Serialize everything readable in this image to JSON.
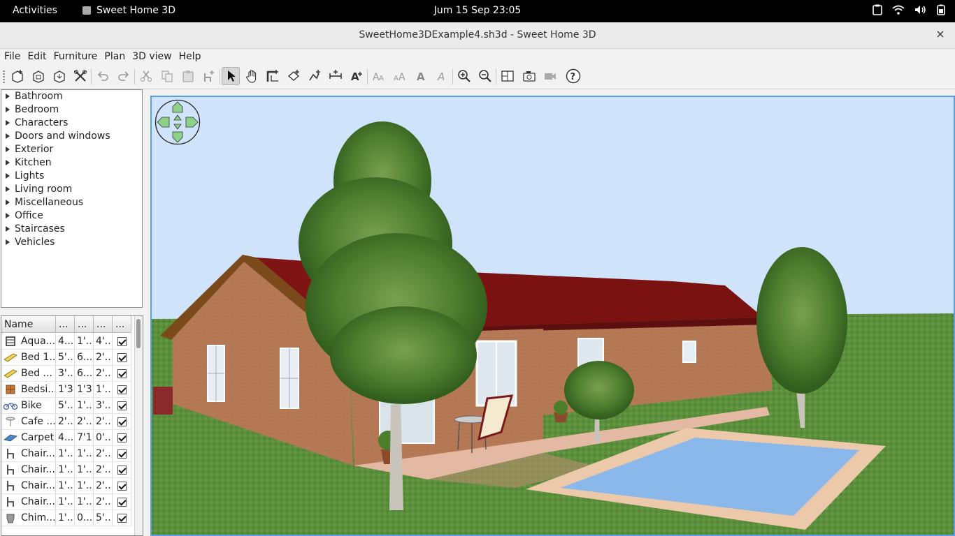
{
  "topbar": {
    "activities": "Activities",
    "app_name": "Sweet Home 3D",
    "clock": "Jum 15 Sep  23:05",
    "tray_icons": [
      "clipboard-icon",
      "wifi-icon",
      "volume-icon",
      "battery-icon"
    ]
  },
  "window": {
    "title": "SweetHome3DExample4.sh3d - Sweet Home 3D",
    "close": "×"
  },
  "menubar": {
    "items": [
      "File",
      "Edit",
      "Furniture",
      "Plan",
      "3D view",
      "Help"
    ]
  },
  "toolbar": {
    "buttons": [
      "new-home",
      "open",
      "save",
      "preferences",
      "undo",
      "redo",
      "cut",
      "copy",
      "paste",
      "add-furniture",
      "select",
      "pan",
      "create-walls",
      "create-rooms",
      "create-polylines",
      "create-dimensions",
      "add-text",
      "increase-text-size",
      "decrease-text-size",
      "bold",
      "italic",
      "zoom-in",
      "zoom-out",
      "create-photo",
      "create-video",
      "help"
    ],
    "active": "select"
  },
  "catalog": {
    "categories": [
      "Bathroom",
      "Bedroom",
      "Characters",
      "Doors and windows",
      "Exterior",
      "Kitchen",
      "Lights",
      "Living room",
      "Miscellaneous",
      "Office",
      "Staircases",
      "Vehicles"
    ]
  },
  "furniture": {
    "columns": [
      "Name",
      "...",
      "...",
      "...",
      "..."
    ],
    "rows": [
      {
        "name": "Aqua...",
        "w": "4...",
        "d": "1'...",
        "h": "4'...",
        "visible": true,
        "icon": "aquarium-icon"
      },
      {
        "name": "Bed 1...",
        "w": "5'...",
        "d": "6...",
        "h": "2'...",
        "visible": true,
        "icon": "bed-icon"
      },
      {
        "name": "Bed ...",
        "w": "3'...",
        "d": "6...",
        "h": "2'...",
        "visible": true,
        "icon": "bed-icon"
      },
      {
        "name": "Bedsi...",
        "w": "1'3\"",
        "d": "1'3\"",
        "h": "1'...",
        "visible": true,
        "icon": "bedside-table-icon"
      },
      {
        "name": "Bike",
        "w": "5'...",
        "d": "1'...",
        "h": "3'...",
        "visible": true,
        "icon": "bike-icon"
      },
      {
        "name": "Cafe ...",
        "w": "2'...",
        "d": "2'...",
        "h": "2'...",
        "visible": true,
        "icon": "cafe-table-icon"
      },
      {
        "name": "Carpet",
        "w": "4...",
        "d": "7'1\"",
        "h": "0'...",
        "visible": true,
        "icon": "carpet-icon"
      },
      {
        "name": "Chair...",
        "w": "1'...",
        "d": "1'...",
        "h": "2'...",
        "visible": true,
        "icon": "chair-icon"
      },
      {
        "name": "Chair...",
        "w": "1'...",
        "d": "1'...",
        "h": "2'...",
        "visible": true,
        "icon": "chair-icon"
      },
      {
        "name": "Chair...",
        "w": "1'...",
        "d": "1'...",
        "h": "2'...",
        "visible": true,
        "icon": "chair-icon"
      },
      {
        "name": "Chair...",
        "w": "1'...",
        "d": "1'...",
        "h": "2'...",
        "visible": true,
        "icon": "chair-icon"
      },
      {
        "name": "Chim...",
        "w": "1'...",
        "d": "0...",
        "h": "5'...",
        "visible": true,
        "icon": "chimney-icon"
      }
    ]
  },
  "view3d": {
    "navigation": "navigation-arrows",
    "colors": {
      "sky": "#cfe3fb",
      "grass": "#5a8f3a",
      "roof": "#7a1010",
      "walls": "#b87a58",
      "pool": "#8ab8ea"
    }
  }
}
